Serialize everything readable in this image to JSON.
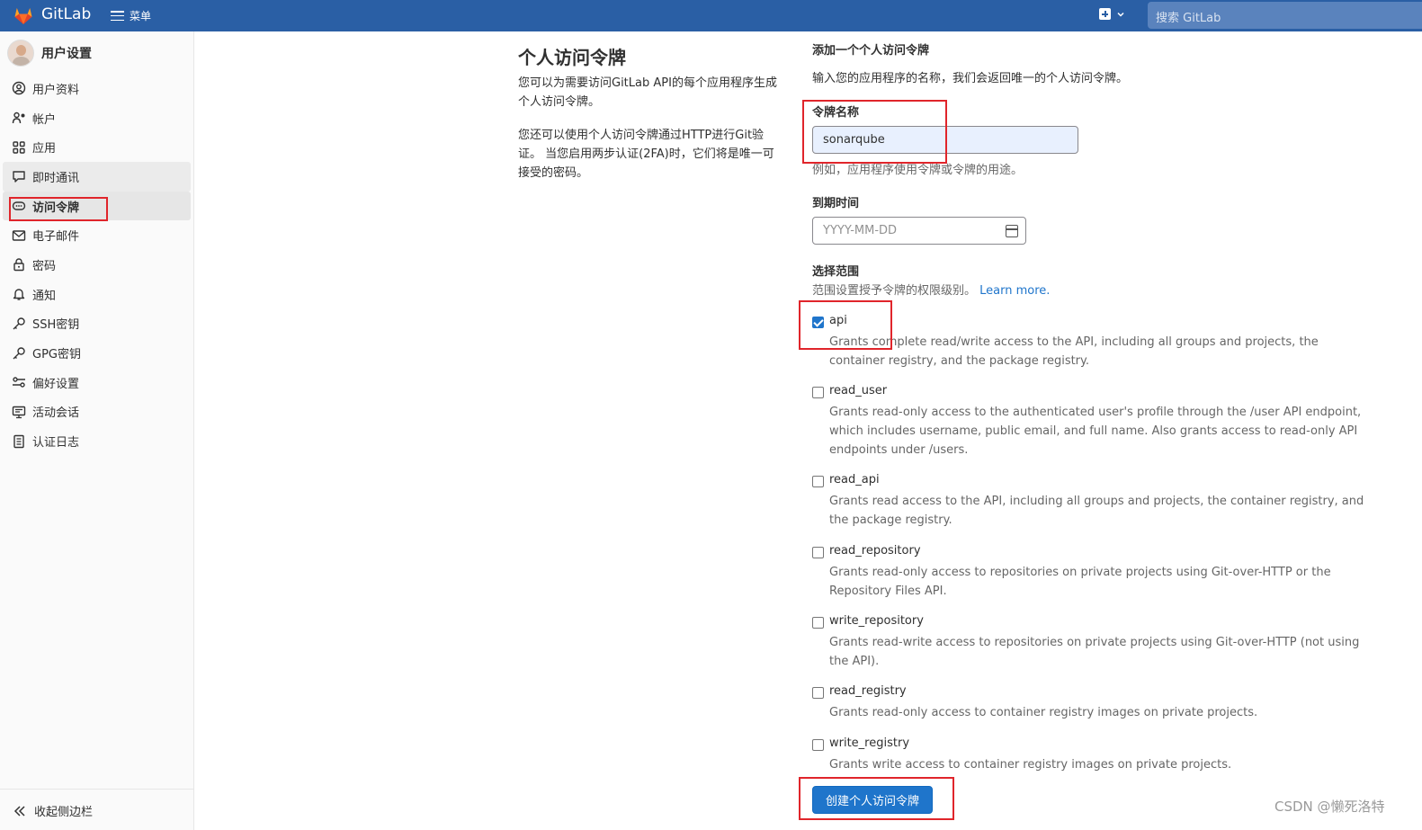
{
  "topbar": {
    "brand": "GitLab",
    "menu_label": "菜单",
    "search_placeholder": "搜索 GitLab",
    "colors": {
      "bar": "#2a5fa5",
      "logo_orange": "#e24329"
    }
  },
  "sidebar": {
    "title": "用户设置",
    "items": [
      {
        "label": "用户资料",
        "icon": "profile-icon"
      },
      {
        "label": "帐户",
        "icon": "account-icon"
      },
      {
        "label": "应用",
        "icon": "applications-icon"
      },
      {
        "label": "即时通讯",
        "icon": "chat-icon"
      },
      {
        "label": "访问令牌",
        "icon": "token-icon"
      },
      {
        "label": "电子邮件",
        "icon": "mail-icon"
      },
      {
        "label": "密码",
        "icon": "lock-icon"
      },
      {
        "label": "通知",
        "icon": "bell-icon"
      },
      {
        "label": "SSH密钥",
        "icon": "key-icon"
      },
      {
        "label": "GPG密钥",
        "icon": "key-icon"
      },
      {
        "label": "偏好设置",
        "icon": "preferences-icon"
      },
      {
        "label": "活动会话",
        "icon": "monitor-icon"
      },
      {
        "label": "认证日志",
        "icon": "log-icon"
      }
    ],
    "active_item": "访问令牌",
    "collapse_label": "收起侧边栏"
  },
  "main": {
    "title": "个人访问令牌",
    "desc1": "您可以为需要访问GitLab API的每个应用程序生成个人访问令牌。",
    "desc2": "您还可以使用个人访问令牌通过HTTP进行Git验证。 当您启用两步认证(2FA)时，它们将是唯一可接受的密码。"
  },
  "form": {
    "heading": "添加一个个人访问令牌",
    "subheading": "输入您的应用程序的名称，我们会返回唯一的个人访问令牌。",
    "name_label": "令牌名称",
    "name_value": "sonarqube",
    "name_hint": "例如，应用程序使用令牌或令牌的用途。",
    "expiry_label": "到期时间",
    "expiry_placeholder": "YYYY-MM-DD",
    "scopes_label": "选择范围",
    "scopes_hint": "范围设置授予令牌的权限级别。",
    "learn_more": "Learn more.",
    "scopes": [
      {
        "name": "api",
        "checked": true,
        "desc": "Grants complete read/write access to the API, including all groups and projects, the container registry, and the package registry."
      },
      {
        "name": "read_user",
        "checked": false,
        "desc": "Grants read-only access to the authenticated user's profile through the /user API endpoint, which includes username, public email, and full name. Also grants access to read-only API endpoints under /users."
      },
      {
        "name": "read_api",
        "checked": false,
        "desc": "Grants read access to the API, including all groups and projects, the container registry, and the package registry."
      },
      {
        "name": "read_repository",
        "checked": false,
        "desc": "Grants read-only access to repositories on private projects using Git-over-HTTP or the Repository Files API."
      },
      {
        "name": "write_repository",
        "checked": false,
        "desc": "Grants read-write access to repositories on private projects using Git-over-HTTP (not using the API)."
      },
      {
        "name": "read_registry",
        "checked": false,
        "desc": "Grants read-only access to container registry images on private projects."
      },
      {
        "name": "write_registry",
        "checked": false,
        "desc": "Grants write access to container registry images on private projects."
      }
    ],
    "submit_label": "创建个人访问令牌"
  },
  "watermark": "CSDN @懒死洛特"
}
